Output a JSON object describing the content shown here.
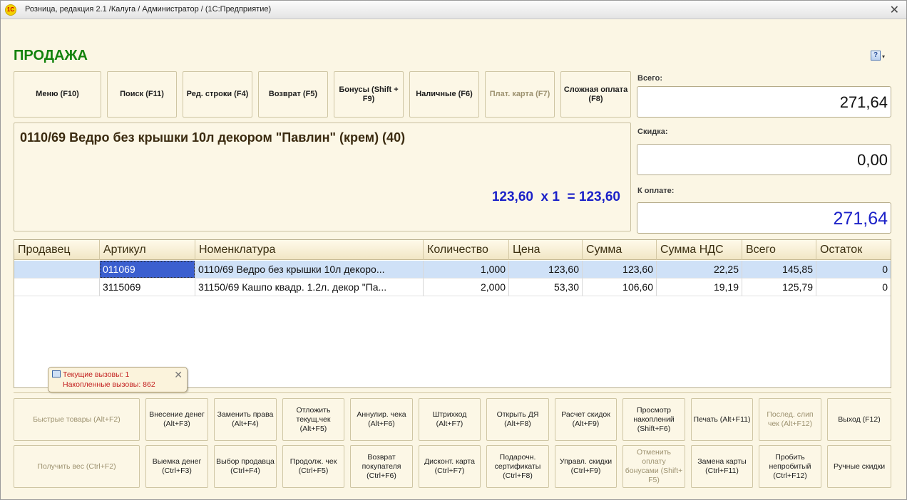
{
  "window": {
    "title": "Розница, редакция 2.1 /Калуга / Администратор /  (1С:Предприятие)",
    "logo": "1С",
    "close": "✕"
  },
  "page_title": "ПРОДАЖА",
  "help_button": {
    "icon": "help-icon",
    "glyph": "?",
    "arrow": "▾"
  },
  "top_buttons": [
    "Меню (F10)",
    "Поиск (F11)",
    "Ред. строки (F4)",
    "Возврат (F5)",
    "Бонусы (Shift + F9)",
    "Наличные (F6)",
    "Плат. карта (F7)",
    "Сложная оплата (F8)"
  ],
  "current_item": {
    "name": "0110/69 Ведро без крышки 10л декором \"Павлин\" (крем) (40)",
    "calc": "123,60  x 1  = 123,60"
  },
  "totals": {
    "total_label": "Всего:",
    "total_value": "271,64",
    "discount_label": "Скидка:",
    "discount_value": "0,00",
    "pay_label": "К оплате:",
    "pay_value": "271,64"
  },
  "table": {
    "columns": [
      "Продавец",
      "Артикул",
      "Номенклатура",
      "Количество",
      "Цена",
      "Сумма",
      "Сумма НДС",
      "Всего",
      "Остаток"
    ],
    "rows": [
      [
        "",
        "011069",
        "0110/69 Ведро без крышки 10л декоро...",
        "1,000",
        "123,60",
        "123,60",
        "22,25",
        "145,85",
        "0"
      ],
      [
        "",
        "3115069",
        "31150/69 Кашпо квадр. 1.2л. декор \"Па...",
        "2,000",
        "53,30",
        "106,60",
        "19,19",
        "125,79",
        "0"
      ]
    ]
  },
  "notification": {
    "line1": "Текущие вызовы: 1",
    "line2": "Накопленные вызовы: 862",
    "close": "✕"
  },
  "bottom_row1": [
    "Быстрые товары (Alt+F2)",
    "Внесение денег (Alt+F3)",
    "Заменить права (Alt+F4)",
    "Отложить текущ.чек (Alt+F5)",
    "Аннулир. чека (Alt+F6)",
    "Штрихкод (Alt+F7)",
    "Открыть ДЯ (Alt+F8)",
    "Расчет скидок (Alt+F9)",
    "Просмотр накоплений (Shift+F6)",
    "Печать (Alt+F11)",
    "Послед. слип чек (Alt+F12)",
    "Выход (F12)"
  ],
  "bottom_row2": [
    "Получить вес (Ctrl+F2)",
    "Выемка денег (Ctrl+F3)",
    "Выбор продавца (Ctrl+F4)",
    "Продолж. чек (Ctrl+F5)",
    "Возврат покупателя (Ctrl+F6)",
    "Дисконт. карта (Ctrl+F7)",
    "Подарочн. сертификаты (Ctrl+F8)",
    "Управл. скидки (Ctrl+F9)",
    "Отменить оплату бонусами (Shift+ F5)",
    "Замена карты (Ctrl+F11)",
    "Пробить непробитый (Ctrl+F12)",
    "Ручные скидки"
  ]
}
